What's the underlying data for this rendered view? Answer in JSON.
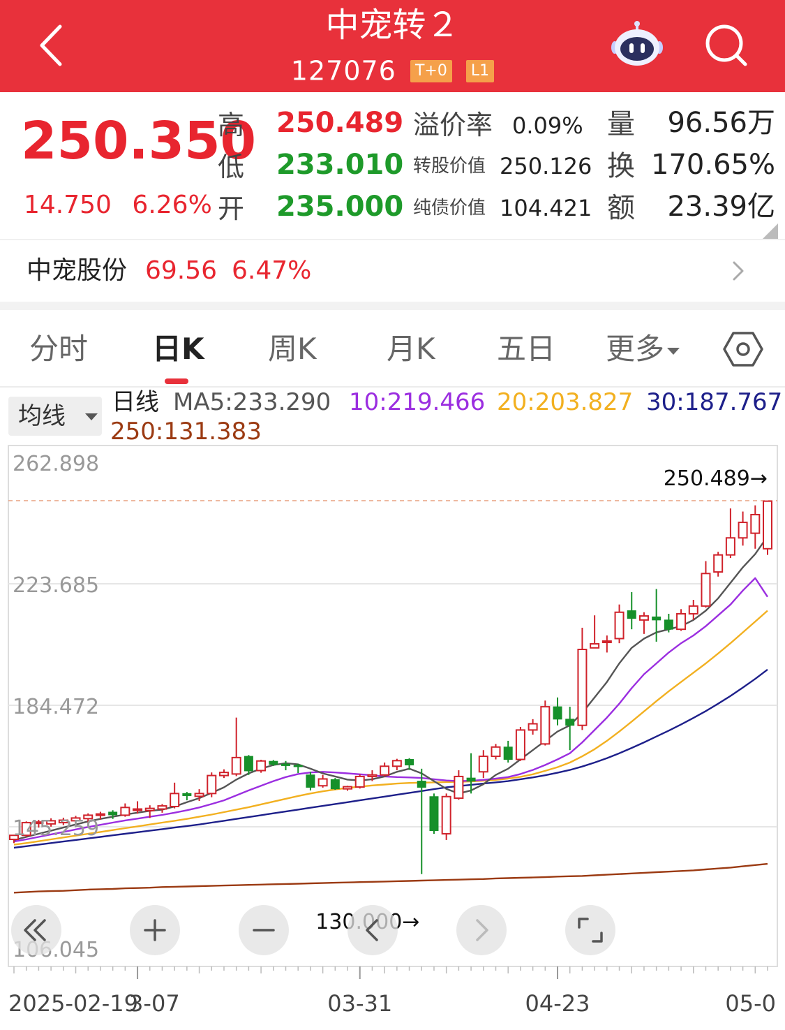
{
  "header": {
    "title": "中宠转２",
    "code": "127076",
    "badges": [
      "T+0",
      "L1"
    ]
  },
  "quote": {
    "price": "250.350",
    "change": "14.750",
    "change_pct": "6.26%",
    "high_label": "高",
    "high": "250.489",
    "low_label": "低",
    "low": "233.010",
    "open_label": "开",
    "open": "235.000",
    "premium_label": "溢价率",
    "premium": "0.09%",
    "conv_value_label": "转股价值",
    "conv_value": "250.126",
    "bond_value_label": "纯债价值",
    "bond_value": "104.421",
    "volume_label": "量",
    "volume": "96.56万",
    "turnover_label": "换",
    "turnover": "170.65%",
    "amount_label": "额",
    "amount": "23.39亿"
  },
  "stock": {
    "name": "中宠股份",
    "price": "69.56",
    "change_pct": "6.47%"
  },
  "tabs": [
    {
      "label": "分时",
      "active": false
    },
    {
      "label": "日K",
      "active": true
    },
    {
      "label": "周K",
      "active": false
    },
    {
      "label": "月K",
      "active": false
    },
    {
      "label": "五日",
      "active": false
    },
    {
      "label": "更多",
      "active": false
    }
  ],
  "ma_legend": {
    "button": "均线",
    "period": "日线",
    "ma5": "MA5:233.290",
    "ma10": "10:219.466",
    "ma20": "20:203.827",
    "ma30": "30:187.767",
    "ma250": "250:131.383"
  },
  "colors": {
    "up": "#d0222b",
    "down": "#16902a",
    "ma5": "#555555",
    "ma10": "#9b2ee0",
    "ma20": "#f2b020",
    "ma30": "#1d1f8a",
    "ma250": "#9b3a12",
    "header_bg": "#e8313b"
  },
  "chart_data": {
    "type": "candlestick",
    "y_ticks": [
      "262.898",
      "223.685",
      "184.472",
      "145.259",
      "106.045"
    ],
    "y_tick_values": [
      262.898,
      223.685,
      184.472,
      145.259,
      106.045
    ],
    "ylim": [
      106.045,
      262.898
    ],
    "x_labels": [
      "2025-02-19",
      "3-07",
      "03-31",
      "04-23",
      "05-0"
    ],
    "x_label_index": [
      0,
      10,
      28,
      44,
      60
    ],
    "max_marker": "250.489→",
    "min_marker": "130.000→",
    "max_value": 250.489,
    "min_value": 130.0,
    "candles": [
      [
        141.2,
        142.5,
        140.0,
        142.6
      ],
      [
        142.5,
        146.6,
        142.0,
        147.0
      ],
      [
        146.6,
        146.8,
        145.0,
        147.5
      ],
      [
        146.2,
        147.2,
        145.3,
        148.0
      ],
      [
        146.6,
        147.4,
        145.8,
        148.2
      ],
      [
        147.2,
        148.1,
        146.0,
        148.8
      ],
      [
        147.9,
        149.0,
        146.6,
        149.6
      ],
      [
        149.0,
        149.4,
        147.6,
        150.1
      ],
      [
        150.0,
        149.1,
        147.8,
        150.6
      ],
      [
        149.0,
        151.5,
        148.5,
        152.8
      ],
      [
        150.6,
        151.0,
        149.5,
        153.5
      ],
      [
        150.5,
        151.2,
        148.1,
        152.2
      ],
      [
        151.0,
        152.0,
        149.8,
        152.6
      ],
      [
        151.8,
        156.0,
        151.2,
        159.5
      ],
      [
        156.0,
        155.3,
        153.8,
        156.5
      ],
      [
        155.1,
        156.0,
        153.6,
        157.4
      ],
      [
        156.0,
        161.8,
        154.8,
        162.8
      ],
      [
        161.8,
        162.8,
        161.0,
        163.8
      ],
      [
        162.3,
        167.6,
        161.6,
        180.5
      ],
      [
        168.0,
        163.3,
        162.0,
        168.4
      ],
      [
        163.4,
        166.5,
        162.7,
        166.9
      ],
      [
        166.4,
        165.4,
        164.9,
        166.8
      ],
      [
        165.5,
        165.0,
        163.5,
        166.5
      ],
      [
        165.1,
        164.9,
        162.6,
        165.6
      ],
      [
        162.0,
        158.0,
        157.0,
        163.0
      ],
      [
        158.5,
        160.7,
        157.9,
        162.0
      ],
      [
        160.5,
        157.5,
        157.2,
        161.0
      ],
      [
        157.5,
        158.2,
        156.9,
        158.5
      ],
      [
        158.1,
        161.5,
        157.6,
        162.2
      ],
      [
        161.5,
        162.0,
        160.0,
        163.5
      ],
      [
        162.0,
        164.8,
        161.5,
        166.0
      ],
      [
        164.8,
        166.6,
        163.5,
        167.2
      ],
      [
        167.0,
        165.2,
        163.6,
        167.4
      ],
      [
        160.0,
        158.0,
        130.0,
        164.0
      ],
      [
        155.0,
        144.0,
        143.0,
        156.0
      ],
      [
        143.0,
        155.0,
        141.0,
        156.0
      ],
      [
        154.5,
        161.5,
        154.0,
        163.5
      ],
      [
        161.0,
        160.0,
        156.0,
        169.0
      ],
      [
        163.0,
        168.0,
        161.0,
        170.0
      ],
      [
        168.0,
        171.0,
        167.0,
        172.0
      ],
      [
        171.0,
        167.0,
        166.0,
        173.0
      ],
      [
        167.0,
        176.5,
        166.5,
        177.5
      ],
      [
        176.5,
        178.5,
        175.0,
        180.0
      ],
      [
        172.0,
        184.0,
        171.5,
        186.0
      ],
      [
        184.0,
        180.0,
        178.0,
        187.0
      ],
      [
        180.0,
        178.0,
        170.0,
        184.0
      ],
      [
        178.0,
        202.5,
        176.5,
        209.5
      ],
      [
        203.0,
        204.3,
        203.5,
        213.5
      ],
      [
        205.0,
        205.2,
        201.5,
        207.0
      ],
      [
        206.0,
        214.5,
        204.5,
        217.0
      ],
      [
        215.0,
        212.5,
        209.0,
        221.0
      ],
      [
        212.0,
        213.3,
        207.5,
        214.5
      ],
      [
        213.0,
        212.0,
        205.0,
        222.0
      ],
      [
        212.0,
        209.0,
        208.0,
        214.0
      ],
      [
        209.0,
        214.0,
        208.5,
        215.5
      ],
      [
        214.0,
        216.5,
        212.0,
        218.5
      ],
      [
        216.5,
        227.0,
        216.0,
        231.0
      ],
      [
        227.5,
        233.0,
        226.0,
        234.0
      ],
      [
        233.0,
        238.5,
        232.0,
        248.0
      ],
      [
        238.5,
        243.5,
        236.0,
        247.0
      ],
      [
        240.0,
        246.0,
        235.0,
        249.0
      ],
      [
        235.0,
        250.35,
        233.0,
        250.489
      ]
    ],
    "ma5": [
      141.0,
      142.0,
      143.0,
      144.0,
      145.0,
      146.0,
      147.0,
      147.8,
      148.5,
      149.2,
      149.8,
      150.4,
      150.8,
      151.8,
      153.2,
      154.5,
      156.2,
      158.0,
      160.5,
      162.5,
      164.0,
      165.2,
      165.8,
      165.4,
      164.0,
      162.5,
      161.5,
      160.5,
      160.2,
      160.6,
      161.5,
      163.0,
      164.0,
      162.5,
      160.0,
      157.5,
      156.0,
      157.0,
      159.0,
      162.0,
      164.0,
      167.0,
      170.0,
      173.0,
      176.0,
      178.0,
      182.0,
      187.0,
      192.0,
      198.0,
      203.0,
      206.0,
      208.0,
      209.0,
      210.0,
      212.0,
      215.0,
      219.0,
      224.0,
      229.0,
      233.29,
      239.0
    ],
    "ma10": [
      140.5,
      141.2,
      142.0,
      142.8,
      143.6,
      144.4,
      145.2,
      145.9,
      146.6,
      147.3,
      147.9,
      148.5,
      149.1,
      149.8,
      150.6,
      151.5,
      152.6,
      153.8,
      155.4,
      157.0,
      158.5,
      160.0,
      161.3,
      162.3,
      162.8,
      163.0,
      162.8,
      162.5,
      162.2,
      161.9,
      161.5,
      161.3,
      161.2,
      161.0,
      160.6,
      160.2,
      160.0,
      160.1,
      160.4,
      160.8,
      161.3,
      162.3,
      163.6,
      165.2,
      167.0,
      169.0,
      172.5,
      176.5,
      180.5,
      185.0,
      190.0,
      194.5,
      198.0,
      201.5,
      204.5,
      207.0,
      210.0,
      213.5,
      217.0,
      221.5,
      225.5,
      219.466
    ],
    "ma20": [
      139.5,
      140.0,
      140.6,
      141.2,
      141.8,
      142.4,
      143.0,
      143.6,
      144.2,
      144.8,
      145.4,
      146.0,
      146.6,
      147.2,
      147.8,
      148.5,
      149.2,
      150.0,
      150.8,
      151.6,
      152.5,
      153.4,
      154.3,
      155.2,
      156.0,
      156.7,
      157.3,
      157.8,
      158.2,
      158.6,
      158.9,
      159.2,
      159.4,
      159.5,
      159.6,
      159.7,
      159.8,
      159.9,
      160.1,
      160.4,
      160.8,
      161.4,
      162.2,
      163.3,
      164.5,
      166.0,
      168.0,
      170.3,
      173.0,
      176.0,
      179.2,
      182.5,
      185.8,
      189.0,
      192.0,
      195.0,
      198.0,
      201.2,
      204.5,
      208.0,
      211.5,
      215.0
    ],
    "ma30": [
      138.5,
      139.0,
      139.5,
      140.0,
      140.5,
      141.0,
      141.5,
      142.0,
      142.5,
      143.0,
      143.5,
      144.0,
      144.5,
      145.0,
      145.5,
      146.0,
      146.6,
      147.2,
      147.8,
      148.4,
      149.0,
      149.6,
      150.2,
      150.8,
      151.4,
      152.0,
      152.6,
      153.2,
      153.8,
      154.4,
      155.0,
      155.6,
      156.2,
      156.8,
      157.4,
      158.0,
      158.4,
      158.8,
      159.2,
      159.6,
      160.0,
      160.6,
      161.2,
      161.9,
      162.7,
      163.6,
      164.7,
      166.0,
      167.4,
      169.0,
      170.7,
      172.5,
      174.4,
      176.3,
      178.3,
      180.4,
      182.6,
      185.0,
      187.5,
      190.2,
      193.0,
      196.0
    ],
    "ma250": [
      124.0,
      124.2,
      124.4,
      124.5,
      124.6,
      124.8,
      125.0,
      125.1,
      125.2,
      125.4,
      125.5,
      125.6,
      125.8,
      125.9,
      126.0,
      126.1,
      126.2,
      126.3,
      126.4,
      126.5,
      126.6,
      126.7,
      126.8,
      126.9,
      127.0,
      127.1,
      127.2,
      127.3,
      127.4,
      127.5,
      127.6,
      127.7,
      127.8,
      127.9,
      128.0,
      128.1,
      128.2,
      128.3,
      128.4,
      128.6,
      128.7,
      128.8,
      128.9,
      129.0,
      129.2,
      129.3,
      129.4,
      129.6,
      129.8,
      130.0,
      130.2,
      130.4,
      130.6,
      130.8,
      131.0,
      131.2,
      131.5,
      131.8,
      132.1,
      132.5,
      132.9,
      133.3
    ]
  }
}
